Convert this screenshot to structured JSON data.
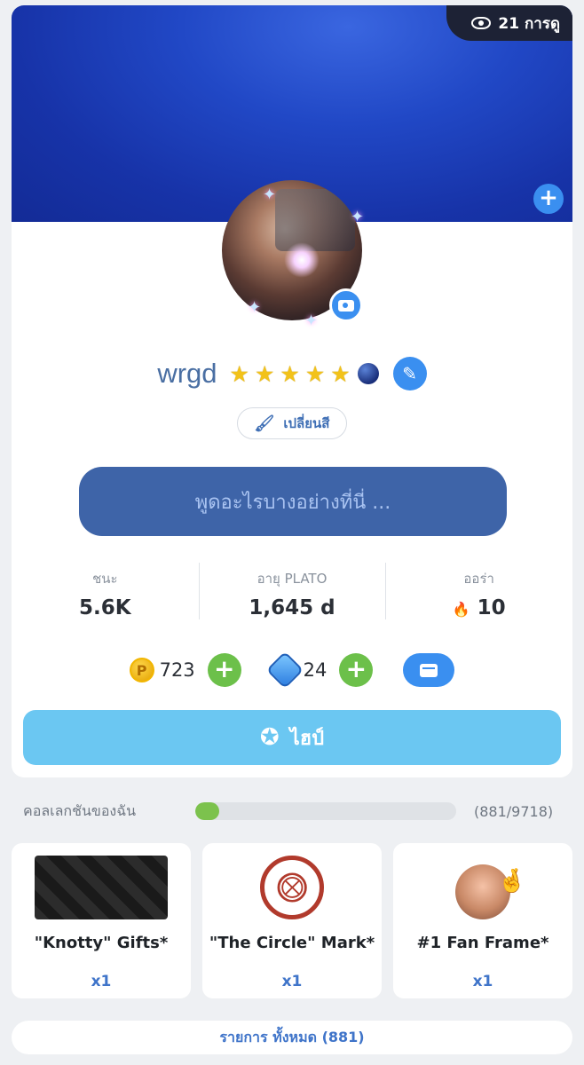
{
  "profile": {
    "views": "21 การดู",
    "username": "wrgd",
    "star_count": 5,
    "change_color_label": "เปลี่ยนสี",
    "status_placeholder": "พูดอะไรบางอย่างที่นี่ ..."
  },
  "stats": [
    {
      "label": "ชนะ",
      "value": "5.6K"
    },
    {
      "label": "อายุ PLATO",
      "value": "1,645 d"
    },
    {
      "label": "ออร่า",
      "value": "10"
    }
  ],
  "wallet": {
    "coin_symbol": "P",
    "coins": "723",
    "gems": "24"
  },
  "hype_label": "ไฮป์",
  "collection": {
    "label": "คอลเลกชันของฉัน",
    "progress_count": "(881/9718)",
    "progress_fraction": 0.0907,
    "items": [
      {
        "name": "\"Knotty\" Gifts*",
        "qty": "x1"
      },
      {
        "name": "\"The Circle\" Mark*",
        "qty": "x1"
      },
      {
        "name": "#1 Fan Frame*",
        "qty": "x1"
      }
    ],
    "all_items_label": "รายการ ทั้งหมด (881)"
  },
  "colors": {
    "accent_blue": "#3a8ff0",
    "status_box": "#3e64a8",
    "hype_button": "#6bc7f2",
    "green_plus": "#6cc04a"
  }
}
